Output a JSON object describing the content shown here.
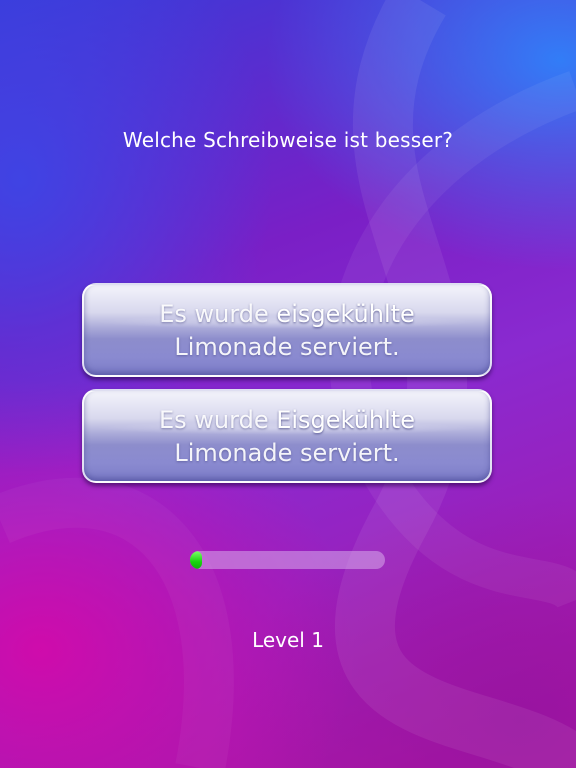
{
  "question": "Welche Schreibweise ist besser?",
  "answers": [
    {
      "prefix": "Es wurde ",
      "keyword": "eisgekühlte",
      "line2": "Limonade serviert."
    },
    {
      "prefix": "Es wurde ",
      "keyword": "Eisgekühlte",
      "line2": "Limonade serviert."
    }
  ],
  "progress": {
    "value": 0.05,
    "fill_color": "#19d40f"
  },
  "level": "Level 1"
}
